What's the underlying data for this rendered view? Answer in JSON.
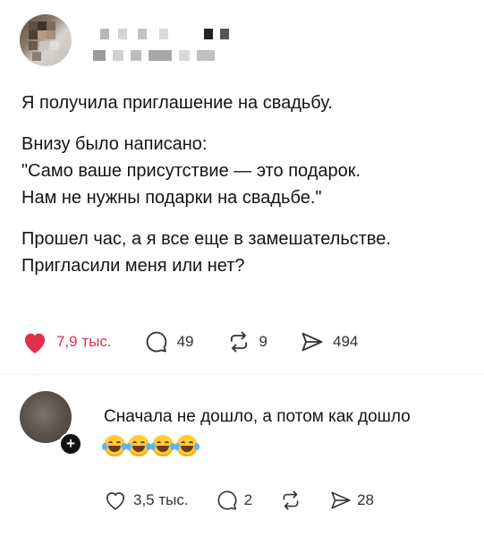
{
  "post": {
    "author": {
      "avatar": "avatar-pixelated",
      "username": ""
    },
    "paragraphs": [
      [
        "Я получила приглашение на свадьбу."
      ],
      [
        "Внизу было написано:",
        "\"Само ваше присутствие — это подарок.",
        "Нам не нужны подарки на свадьбе.\""
      ],
      [
        "Прошел час, а я все еще в замешательстве.",
        "Пригласили меня или нет?"
      ]
    ],
    "actions": {
      "likes": "7,9 тыс.",
      "comments": "49",
      "reposts": "9",
      "shares": "494"
    },
    "colors": {
      "liked": "#e3304a",
      "text": "#141414",
      "muted": "#333333"
    }
  },
  "reply": {
    "plus_icon": "+",
    "text": "Сначала не дошло, а потом как дошло",
    "emoji": [
      "crying-laughing-emoji",
      "crying-laughing-emoji",
      "crying-laughing-emoji",
      "crying-laughing-emoji"
    ],
    "actions": {
      "likes": "3,5 тыс.",
      "comments": "2",
      "shares": "28"
    }
  }
}
